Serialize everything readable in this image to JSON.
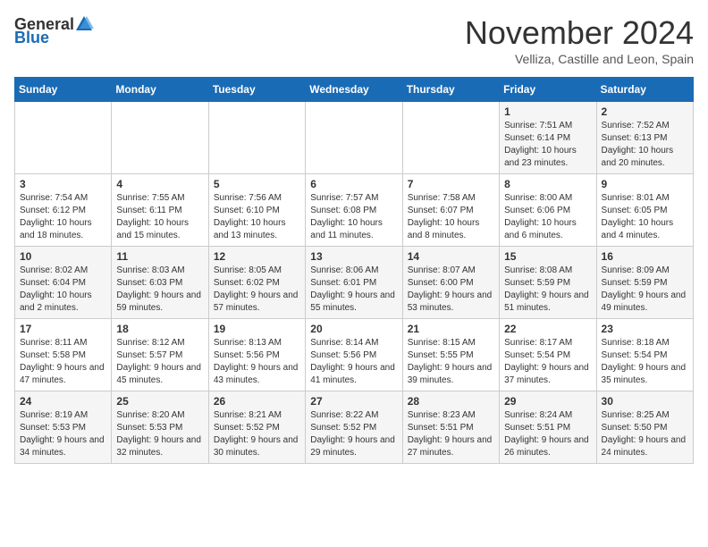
{
  "logo": {
    "general": "General",
    "blue": "Blue"
  },
  "title": "November 2024",
  "subtitle": "Velliza, Castille and Leon, Spain",
  "days_of_week": [
    "Sunday",
    "Monday",
    "Tuesday",
    "Wednesday",
    "Thursday",
    "Friday",
    "Saturday"
  ],
  "weeks": [
    [
      {
        "day": "",
        "info": ""
      },
      {
        "day": "",
        "info": ""
      },
      {
        "day": "",
        "info": ""
      },
      {
        "day": "",
        "info": ""
      },
      {
        "day": "",
        "info": ""
      },
      {
        "day": "1",
        "info": "Sunrise: 7:51 AM\nSunset: 6:14 PM\nDaylight: 10 hours and 23 minutes."
      },
      {
        "day": "2",
        "info": "Sunrise: 7:52 AM\nSunset: 6:13 PM\nDaylight: 10 hours and 20 minutes."
      }
    ],
    [
      {
        "day": "3",
        "info": "Sunrise: 7:54 AM\nSunset: 6:12 PM\nDaylight: 10 hours and 18 minutes."
      },
      {
        "day": "4",
        "info": "Sunrise: 7:55 AM\nSunset: 6:11 PM\nDaylight: 10 hours and 15 minutes."
      },
      {
        "day": "5",
        "info": "Sunrise: 7:56 AM\nSunset: 6:10 PM\nDaylight: 10 hours and 13 minutes."
      },
      {
        "day": "6",
        "info": "Sunrise: 7:57 AM\nSunset: 6:08 PM\nDaylight: 10 hours and 11 minutes."
      },
      {
        "day": "7",
        "info": "Sunrise: 7:58 AM\nSunset: 6:07 PM\nDaylight: 10 hours and 8 minutes."
      },
      {
        "day": "8",
        "info": "Sunrise: 8:00 AM\nSunset: 6:06 PM\nDaylight: 10 hours and 6 minutes."
      },
      {
        "day": "9",
        "info": "Sunrise: 8:01 AM\nSunset: 6:05 PM\nDaylight: 10 hours and 4 minutes."
      }
    ],
    [
      {
        "day": "10",
        "info": "Sunrise: 8:02 AM\nSunset: 6:04 PM\nDaylight: 10 hours and 2 minutes."
      },
      {
        "day": "11",
        "info": "Sunrise: 8:03 AM\nSunset: 6:03 PM\nDaylight: 9 hours and 59 minutes."
      },
      {
        "day": "12",
        "info": "Sunrise: 8:05 AM\nSunset: 6:02 PM\nDaylight: 9 hours and 57 minutes."
      },
      {
        "day": "13",
        "info": "Sunrise: 8:06 AM\nSunset: 6:01 PM\nDaylight: 9 hours and 55 minutes."
      },
      {
        "day": "14",
        "info": "Sunrise: 8:07 AM\nSunset: 6:00 PM\nDaylight: 9 hours and 53 minutes."
      },
      {
        "day": "15",
        "info": "Sunrise: 8:08 AM\nSunset: 5:59 PM\nDaylight: 9 hours and 51 minutes."
      },
      {
        "day": "16",
        "info": "Sunrise: 8:09 AM\nSunset: 5:59 PM\nDaylight: 9 hours and 49 minutes."
      }
    ],
    [
      {
        "day": "17",
        "info": "Sunrise: 8:11 AM\nSunset: 5:58 PM\nDaylight: 9 hours and 47 minutes."
      },
      {
        "day": "18",
        "info": "Sunrise: 8:12 AM\nSunset: 5:57 PM\nDaylight: 9 hours and 45 minutes."
      },
      {
        "day": "19",
        "info": "Sunrise: 8:13 AM\nSunset: 5:56 PM\nDaylight: 9 hours and 43 minutes."
      },
      {
        "day": "20",
        "info": "Sunrise: 8:14 AM\nSunset: 5:56 PM\nDaylight: 9 hours and 41 minutes."
      },
      {
        "day": "21",
        "info": "Sunrise: 8:15 AM\nSunset: 5:55 PM\nDaylight: 9 hours and 39 minutes."
      },
      {
        "day": "22",
        "info": "Sunrise: 8:17 AM\nSunset: 5:54 PM\nDaylight: 9 hours and 37 minutes."
      },
      {
        "day": "23",
        "info": "Sunrise: 8:18 AM\nSunset: 5:54 PM\nDaylight: 9 hours and 35 minutes."
      }
    ],
    [
      {
        "day": "24",
        "info": "Sunrise: 8:19 AM\nSunset: 5:53 PM\nDaylight: 9 hours and 34 minutes."
      },
      {
        "day": "25",
        "info": "Sunrise: 8:20 AM\nSunset: 5:53 PM\nDaylight: 9 hours and 32 minutes."
      },
      {
        "day": "26",
        "info": "Sunrise: 8:21 AM\nSunset: 5:52 PM\nDaylight: 9 hours and 30 minutes."
      },
      {
        "day": "27",
        "info": "Sunrise: 8:22 AM\nSunset: 5:52 PM\nDaylight: 9 hours and 29 minutes."
      },
      {
        "day": "28",
        "info": "Sunrise: 8:23 AM\nSunset: 5:51 PM\nDaylight: 9 hours and 27 minutes."
      },
      {
        "day": "29",
        "info": "Sunrise: 8:24 AM\nSunset: 5:51 PM\nDaylight: 9 hours and 26 minutes."
      },
      {
        "day": "30",
        "info": "Sunrise: 8:25 AM\nSunset: 5:50 PM\nDaylight: 9 hours and 24 minutes."
      }
    ]
  ]
}
